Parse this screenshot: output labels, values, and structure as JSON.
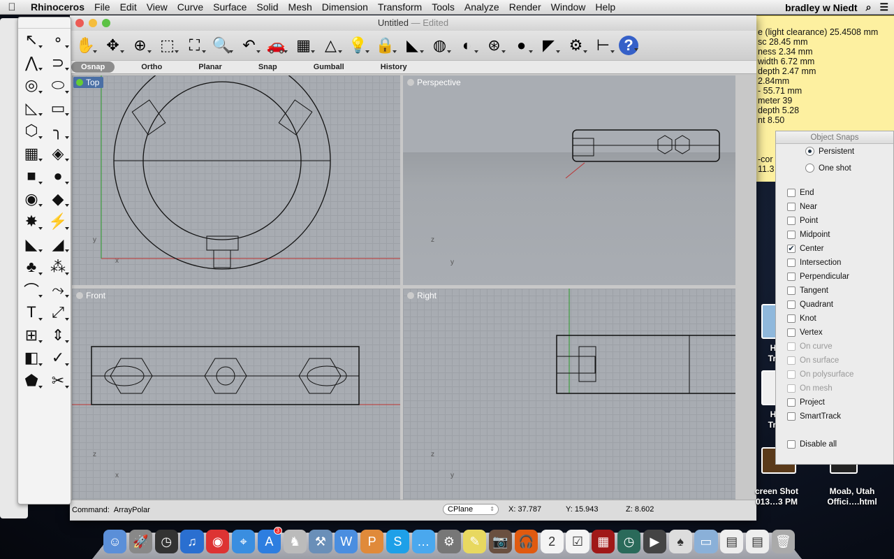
{
  "menubar": {
    "app": "Rhinoceros",
    "items": [
      "File",
      "Edit",
      "View",
      "Curve",
      "Surface",
      "Solid",
      "Mesh",
      "Dimension",
      "Transform",
      "Tools",
      "Analyze",
      "Render",
      "Window",
      "Help"
    ],
    "user": "bradley w Niedt"
  },
  "note": {
    "lines": [
      "e (light clearance) 25.4508 mm",
      "sc 28.45 mm",
      "ness 2.34 mm",
      "width 6.72 mm",
      "depth 2.47 mm",
      " 2.84mm",
      "- 55.71 mm",
      "meter 39",
      "depth 5.28",
      "nt 8.50",
      "",
      "",
      "",
      "-cor",
      "11.3"
    ]
  },
  "window": {
    "title": "Untitled",
    "edited": " — Edited"
  },
  "toolbar": {
    "icons": [
      {
        "name": "pan",
        "g": "✋"
      },
      {
        "name": "rotate-view",
        "g": "✥"
      },
      {
        "name": "zoom-in-out",
        "g": "⊕"
      },
      {
        "name": "zoom-window",
        "g": "⬚"
      },
      {
        "name": "zoom-extents",
        "g": "⛶"
      },
      {
        "name": "zoom-selected",
        "g": "🔍"
      },
      {
        "name": "undo-view",
        "g": "↶"
      },
      {
        "name": "car-named-views",
        "g": "🚗"
      },
      {
        "name": "cplane",
        "g": "▦"
      },
      {
        "name": "object-properties",
        "g": "△"
      },
      {
        "name": "lightbulb",
        "g": "💡"
      },
      {
        "name": "lock",
        "g": "🔒"
      },
      {
        "name": "layers",
        "g": "◣"
      },
      {
        "name": "color-wheel",
        "g": "◍"
      },
      {
        "name": "wireframe-sphere",
        "g": "◐"
      },
      {
        "name": "grid-sphere",
        "g": "⊛"
      },
      {
        "name": "render-sphere",
        "g": "●"
      },
      {
        "name": "cone-light",
        "g": "◤"
      },
      {
        "name": "settings-gear",
        "g": "⚙"
      },
      {
        "name": "dimensions",
        "g": "⊢"
      },
      {
        "name": "help",
        "g": "?"
      }
    ]
  },
  "toggles": [
    {
      "label": "Osnap",
      "on": true
    },
    {
      "label": "Ortho",
      "on": false
    },
    {
      "label": "Planar",
      "on": false
    },
    {
      "label": "Snap",
      "on": false
    },
    {
      "label": "Gumball",
      "on": false
    },
    {
      "label": "History",
      "on": false
    }
  ],
  "viewports": {
    "top": "Top",
    "perspective": "Perspective",
    "front": "Front",
    "right": "Right"
  },
  "command": {
    "label": "Command:",
    "value": "ArrayPolar"
  },
  "status": {
    "cplane": "CPlane",
    "x": "X: 37.787",
    "y": "Y: 15.943",
    "z": "Z: 8.602"
  },
  "palette": {
    "tools": [
      "select-arrow",
      "point",
      "polyline",
      "curve",
      "circle",
      "ellipse",
      "arc",
      "rectangle",
      "polygon",
      "fillet-curve",
      "surface-from-points",
      "surface-patch",
      "box",
      "sphere",
      "cylinder",
      "surface-patch-2",
      "transform-explode",
      "split",
      "trim",
      "extend",
      "boolean-union",
      "boolean-split",
      "offset",
      "curve-blend",
      "text",
      "scale",
      "array",
      "move-to-layer",
      "solid-edit",
      "extrude",
      "grid-array",
      "dimension",
      "chamfer",
      "checkmark",
      "blocks",
      "paint"
    ],
    "glyphs": [
      "↖",
      "∘",
      "⋀",
      "⊃",
      "◎",
      "⬭",
      "◺",
      "▭",
      "⬡",
      "╮",
      "▦",
      "◈",
      "■",
      "●",
      "◉",
      "◆",
      "✸",
      "⚡",
      "◣",
      "◢",
      "♣",
      "⁂",
      "⌒",
      "⤳",
      "T",
      "⤢",
      "⊞",
      "⇕",
      "◧",
      "✓",
      "⬟",
      "✂"
    ]
  },
  "snaps": {
    "title": "Object Snaps",
    "modes": [
      {
        "label": "Persistent",
        "on": true
      },
      {
        "label": "One shot",
        "on": false
      }
    ],
    "items": [
      {
        "label": "End",
        "checked": false,
        "enabled": true
      },
      {
        "label": "Near",
        "checked": false,
        "enabled": true
      },
      {
        "label": "Point",
        "checked": false,
        "enabled": true
      },
      {
        "label": "Midpoint",
        "checked": false,
        "enabled": true
      },
      {
        "label": "Center",
        "checked": true,
        "enabled": true
      },
      {
        "label": "Intersection",
        "checked": false,
        "enabled": true
      },
      {
        "label": "Perpendicular",
        "checked": false,
        "enabled": true
      },
      {
        "label": "Tangent",
        "checked": false,
        "enabled": true
      },
      {
        "label": "Quadrant",
        "checked": false,
        "enabled": true
      },
      {
        "label": "Knot",
        "checked": false,
        "enabled": true
      },
      {
        "label": "Vertex",
        "checked": false,
        "enabled": true
      },
      {
        "label": "On curve",
        "checked": false,
        "enabled": false
      },
      {
        "label": "On surface",
        "checked": false,
        "enabled": false
      },
      {
        "label": "On polysurface",
        "checked": false,
        "enabled": false
      },
      {
        "label": "On mesh",
        "checked": false,
        "enabled": false
      },
      {
        "label": "Project",
        "checked": false,
        "enabled": true
      },
      {
        "label": "SmartTrack",
        "checked": false,
        "enabled": true
      }
    ],
    "disable_all": "Disable all"
  },
  "desktop": {
    "icons": [
      {
        "l1": "Hik",
        "l2": "Trail"
      },
      {
        "l1": "Hik",
        "l2": "Trail"
      },
      {
        "l1": "creen Shot",
        "l2": "013…3 PM"
      },
      {
        "l1": "Moab, Utah",
        "l2": "Offici….html"
      }
    ]
  },
  "dock": {
    "apps": [
      {
        "name": "finder",
        "c": "#5b8fd8",
        "g": "☺"
      },
      {
        "name": "launchpad",
        "c": "#888",
        "g": "🚀"
      },
      {
        "name": "dashboard",
        "c": "#333",
        "g": "◷"
      },
      {
        "name": "itunes",
        "c": "#2a6fd0",
        "g": "♫"
      },
      {
        "name": "chrome",
        "c": "#d33",
        "g": "◉"
      },
      {
        "name": "safari",
        "c": "#3a8ee0",
        "g": "⌖"
      },
      {
        "name": "app-store",
        "c": "#2d7ee0",
        "g": "A",
        "badge": "3"
      },
      {
        "name": "rhinoceros",
        "c": "#bbb",
        "g": "♞"
      },
      {
        "name": "xcode",
        "c": "#6a8fb8",
        "g": "⚒"
      },
      {
        "name": "word",
        "c": "#4a8ee0",
        "g": "W"
      },
      {
        "name": "powerpoint",
        "c": "#e08a3a",
        "g": "P"
      },
      {
        "name": "skype",
        "c": "#1ea0e8",
        "g": "S"
      },
      {
        "name": "messages",
        "c": "#4aa8ee",
        "g": "…"
      },
      {
        "name": "system-preferences",
        "c": "#777",
        "g": "⚙"
      },
      {
        "name": "stickies",
        "c": "#e8d860",
        "g": "✎"
      },
      {
        "name": "image-capture",
        "c": "#6a5040",
        "g": "📷"
      },
      {
        "name": "audacity",
        "c": "#e05a10",
        "g": "🎧"
      },
      {
        "name": "calendar",
        "c": "#f4f4f4",
        "g": "2"
      },
      {
        "name": "reminders",
        "c": "#f4f4f4",
        "g": "☑"
      },
      {
        "name": "photo-booth",
        "c": "#a01818",
        "g": "▦"
      },
      {
        "name": "time-machine",
        "c": "#2a6a5a",
        "g": "◷"
      },
      {
        "name": "dvd-player",
        "c": "#444",
        "g": "▶"
      },
      {
        "name": "solitaire",
        "c": "#ddd",
        "g": "♠"
      },
      {
        "name": "folder",
        "c": "#8ab0d8",
        "g": "▭"
      },
      {
        "name": "document",
        "c": "#eee",
        "g": "▤"
      },
      {
        "name": "chrome-document",
        "c": "#eee",
        "g": "▤"
      },
      {
        "name": "trash",
        "c": "#aaa",
        "g": "🗑"
      }
    ]
  }
}
